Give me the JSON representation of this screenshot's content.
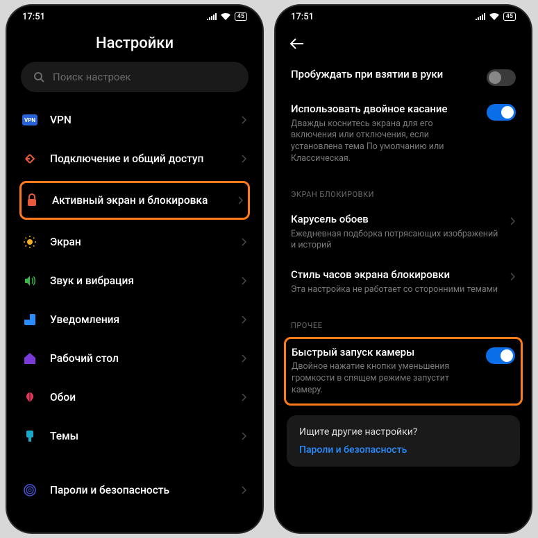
{
  "status": {
    "time": "17:51",
    "battery": "45"
  },
  "left": {
    "title": "Настройки",
    "search_placeholder": "Поиск настроек",
    "items": [
      {
        "label": "VPN"
      },
      {
        "label": "Подключение и общий доступ"
      },
      {
        "label": "Активный экран и блокировка"
      },
      {
        "label": "Экран"
      },
      {
        "label": "Звук и вибрация"
      },
      {
        "label": "Уведомления"
      },
      {
        "label": "Рабочий стол"
      },
      {
        "label": "Обои"
      },
      {
        "label": "Темы"
      },
      {
        "label": "Пароли и безопасность"
      }
    ]
  },
  "right": {
    "rows": [
      {
        "title": "Пробуждать при взятии в руки",
        "toggle": "off"
      },
      {
        "title": "Использовать двойное касание",
        "sub": "Дважды коснитесь экрана для его включения или отключения, если установлена тема По умолчанию или Классическая.",
        "toggle": "on"
      }
    ],
    "section1": "ЭКРАН БЛОКИРОВКИ",
    "lock_rows": [
      {
        "title": "Карусель обоев",
        "sub": "Ежедневная подборка потрясающих изображений и историй"
      },
      {
        "title": "Стиль часов экрана блокировки",
        "sub": "Эта настройка не работает со сторонними темами"
      }
    ],
    "section2": "ПРОЧЕЕ",
    "camera": {
      "title": "Быстрый запуск камеры",
      "sub": "Двойное нажатие кнопки уменьшения громкости в спящем режиме запустит камеру.",
      "toggle": "on"
    },
    "footer": {
      "q": "Ищите другие настройки?",
      "link": "Пароли и безопасность"
    }
  }
}
